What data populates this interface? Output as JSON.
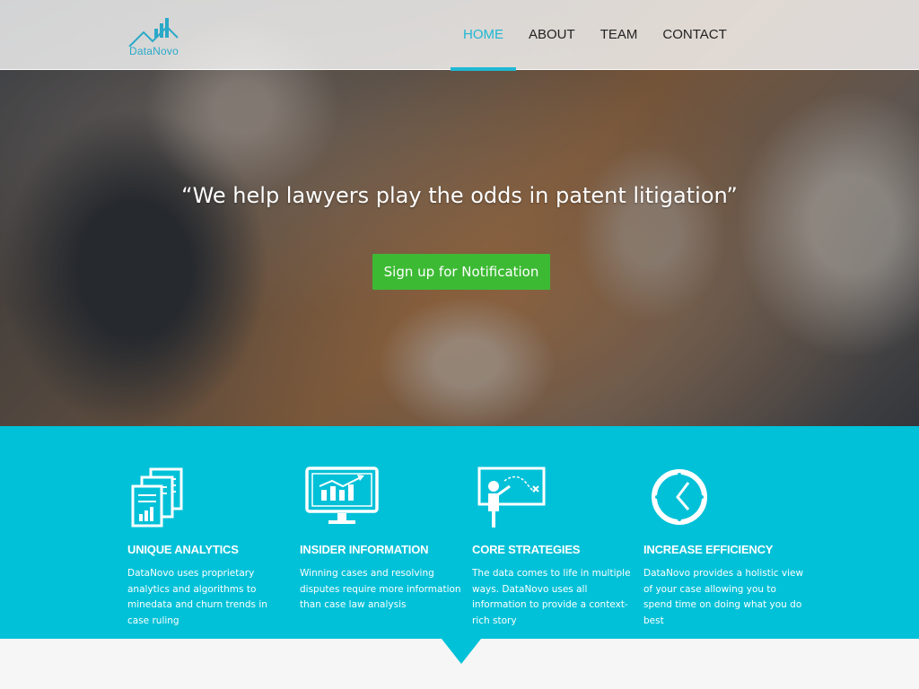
{
  "brand": {
    "name": "DataNovo",
    "accent_color": "#1fb8d3",
    "feature_bg": "#00c1d8",
    "cta_color": "#3dba34"
  },
  "nav": {
    "items": [
      {
        "label": "HOME",
        "active": true
      },
      {
        "label": "ABOUT",
        "active": false
      },
      {
        "label": "TEAM",
        "active": false
      },
      {
        "label": "CONTACT",
        "active": false
      }
    ]
  },
  "hero": {
    "quote": "“We help lawyers play the odds in patent litigation”",
    "cta_label": "Sign up for Notification"
  },
  "features": [
    {
      "icon": "documents-chart-icon",
      "title": "UNIQUE ANALYTICS",
      "text": "DataNovo uses proprietary analytics and algorithms to minedata and churn trends in case ruling"
    },
    {
      "icon": "monitor-chart-icon",
      "title": "INSIDER INFORMATION",
      "text": "Winning cases and resolving disputes require more information than case law analysis"
    },
    {
      "icon": "presenter-board-icon",
      "title": "CORE STRATEGIES",
      "text": "The data comes to life in multiple ways. DataNovo uses all information to provide a context-rich story"
    },
    {
      "icon": "clock-icon",
      "title": "INCREASE EFFICIENCY",
      "text": "DataNovo provides a holistic view of your case allowing you to spend time on doing what you do best"
    }
  ]
}
